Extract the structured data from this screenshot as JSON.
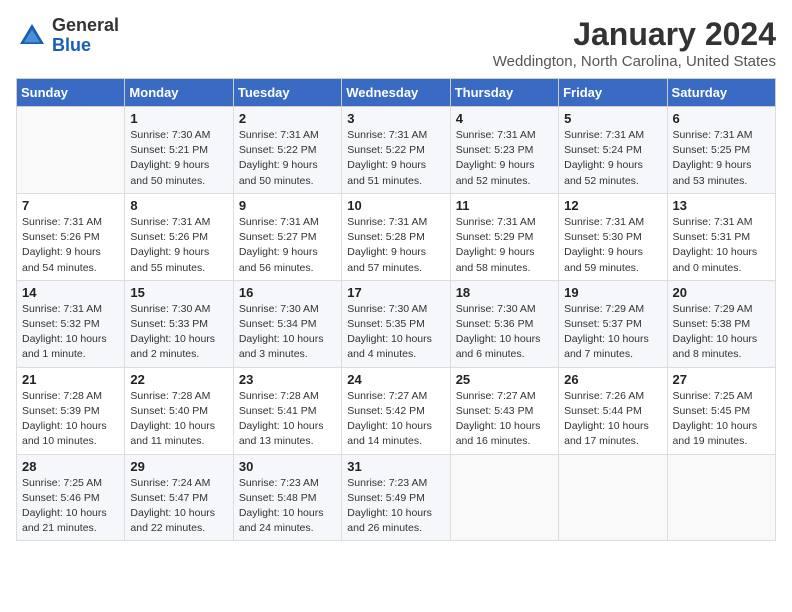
{
  "header": {
    "logo_general": "General",
    "logo_blue": "Blue",
    "title": "January 2024",
    "location": "Weddington, North Carolina, United States"
  },
  "calendar": {
    "days_of_week": [
      "Sunday",
      "Monday",
      "Tuesday",
      "Wednesday",
      "Thursday",
      "Friday",
      "Saturday"
    ],
    "weeks": [
      [
        {
          "num": "",
          "sunrise": "",
          "sunset": "",
          "daylight": ""
        },
        {
          "num": "1",
          "sunrise": "Sunrise: 7:30 AM",
          "sunset": "Sunset: 5:21 PM",
          "daylight": "Daylight: 9 hours and 50 minutes."
        },
        {
          "num": "2",
          "sunrise": "Sunrise: 7:31 AM",
          "sunset": "Sunset: 5:22 PM",
          "daylight": "Daylight: 9 hours and 50 minutes."
        },
        {
          "num": "3",
          "sunrise": "Sunrise: 7:31 AM",
          "sunset": "Sunset: 5:22 PM",
          "daylight": "Daylight: 9 hours and 51 minutes."
        },
        {
          "num": "4",
          "sunrise": "Sunrise: 7:31 AM",
          "sunset": "Sunset: 5:23 PM",
          "daylight": "Daylight: 9 hours and 52 minutes."
        },
        {
          "num": "5",
          "sunrise": "Sunrise: 7:31 AM",
          "sunset": "Sunset: 5:24 PM",
          "daylight": "Daylight: 9 hours and 52 minutes."
        },
        {
          "num": "6",
          "sunrise": "Sunrise: 7:31 AM",
          "sunset": "Sunset: 5:25 PM",
          "daylight": "Daylight: 9 hours and 53 minutes."
        }
      ],
      [
        {
          "num": "7",
          "sunrise": "Sunrise: 7:31 AM",
          "sunset": "Sunset: 5:26 PM",
          "daylight": "Daylight: 9 hours and 54 minutes."
        },
        {
          "num": "8",
          "sunrise": "Sunrise: 7:31 AM",
          "sunset": "Sunset: 5:26 PM",
          "daylight": "Daylight: 9 hours and 55 minutes."
        },
        {
          "num": "9",
          "sunrise": "Sunrise: 7:31 AM",
          "sunset": "Sunset: 5:27 PM",
          "daylight": "Daylight: 9 hours and 56 minutes."
        },
        {
          "num": "10",
          "sunrise": "Sunrise: 7:31 AM",
          "sunset": "Sunset: 5:28 PM",
          "daylight": "Daylight: 9 hours and 57 minutes."
        },
        {
          "num": "11",
          "sunrise": "Sunrise: 7:31 AM",
          "sunset": "Sunset: 5:29 PM",
          "daylight": "Daylight: 9 hours and 58 minutes."
        },
        {
          "num": "12",
          "sunrise": "Sunrise: 7:31 AM",
          "sunset": "Sunset: 5:30 PM",
          "daylight": "Daylight: 9 hours and 59 minutes."
        },
        {
          "num": "13",
          "sunrise": "Sunrise: 7:31 AM",
          "sunset": "Sunset: 5:31 PM",
          "daylight": "Daylight: 10 hours and 0 minutes."
        }
      ],
      [
        {
          "num": "14",
          "sunrise": "Sunrise: 7:31 AM",
          "sunset": "Sunset: 5:32 PM",
          "daylight": "Daylight: 10 hours and 1 minute."
        },
        {
          "num": "15",
          "sunrise": "Sunrise: 7:30 AM",
          "sunset": "Sunset: 5:33 PM",
          "daylight": "Daylight: 10 hours and 2 minutes."
        },
        {
          "num": "16",
          "sunrise": "Sunrise: 7:30 AM",
          "sunset": "Sunset: 5:34 PM",
          "daylight": "Daylight: 10 hours and 3 minutes."
        },
        {
          "num": "17",
          "sunrise": "Sunrise: 7:30 AM",
          "sunset": "Sunset: 5:35 PM",
          "daylight": "Daylight: 10 hours and 4 minutes."
        },
        {
          "num": "18",
          "sunrise": "Sunrise: 7:30 AM",
          "sunset": "Sunset: 5:36 PM",
          "daylight": "Daylight: 10 hours and 6 minutes."
        },
        {
          "num": "19",
          "sunrise": "Sunrise: 7:29 AM",
          "sunset": "Sunset: 5:37 PM",
          "daylight": "Daylight: 10 hours and 7 minutes."
        },
        {
          "num": "20",
          "sunrise": "Sunrise: 7:29 AM",
          "sunset": "Sunset: 5:38 PM",
          "daylight": "Daylight: 10 hours and 8 minutes."
        }
      ],
      [
        {
          "num": "21",
          "sunrise": "Sunrise: 7:28 AM",
          "sunset": "Sunset: 5:39 PM",
          "daylight": "Daylight: 10 hours and 10 minutes."
        },
        {
          "num": "22",
          "sunrise": "Sunrise: 7:28 AM",
          "sunset": "Sunset: 5:40 PM",
          "daylight": "Daylight: 10 hours and 11 minutes."
        },
        {
          "num": "23",
          "sunrise": "Sunrise: 7:28 AM",
          "sunset": "Sunset: 5:41 PM",
          "daylight": "Daylight: 10 hours and 13 minutes."
        },
        {
          "num": "24",
          "sunrise": "Sunrise: 7:27 AM",
          "sunset": "Sunset: 5:42 PM",
          "daylight": "Daylight: 10 hours and 14 minutes."
        },
        {
          "num": "25",
          "sunrise": "Sunrise: 7:27 AM",
          "sunset": "Sunset: 5:43 PM",
          "daylight": "Daylight: 10 hours and 16 minutes."
        },
        {
          "num": "26",
          "sunrise": "Sunrise: 7:26 AM",
          "sunset": "Sunset: 5:44 PM",
          "daylight": "Daylight: 10 hours and 17 minutes."
        },
        {
          "num": "27",
          "sunrise": "Sunrise: 7:25 AM",
          "sunset": "Sunset: 5:45 PM",
          "daylight": "Daylight: 10 hours and 19 minutes."
        }
      ],
      [
        {
          "num": "28",
          "sunrise": "Sunrise: 7:25 AM",
          "sunset": "Sunset: 5:46 PM",
          "daylight": "Daylight: 10 hours and 21 minutes."
        },
        {
          "num": "29",
          "sunrise": "Sunrise: 7:24 AM",
          "sunset": "Sunset: 5:47 PM",
          "daylight": "Daylight: 10 hours and 22 minutes."
        },
        {
          "num": "30",
          "sunrise": "Sunrise: 7:23 AM",
          "sunset": "Sunset: 5:48 PM",
          "daylight": "Daylight: 10 hours and 24 minutes."
        },
        {
          "num": "31",
          "sunrise": "Sunrise: 7:23 AM",
          "sunset": "Sunset: 5:49 PM",
          "daylight": "Daylight: 10 hours and 26 minutes."
        },
        {
          "num": "",
          "sunrise": "",
          "sunset": "",
          "daylight": ""
        },
        {
          "num": "",
          "sunrise": "",
          "sunset": "",
          "daylight": ""
        },
        {
          "num": "",
          "sunrise": "",
          "sunset": "",
          "daylight": ""
        }
      ]
    ]
  }
}
